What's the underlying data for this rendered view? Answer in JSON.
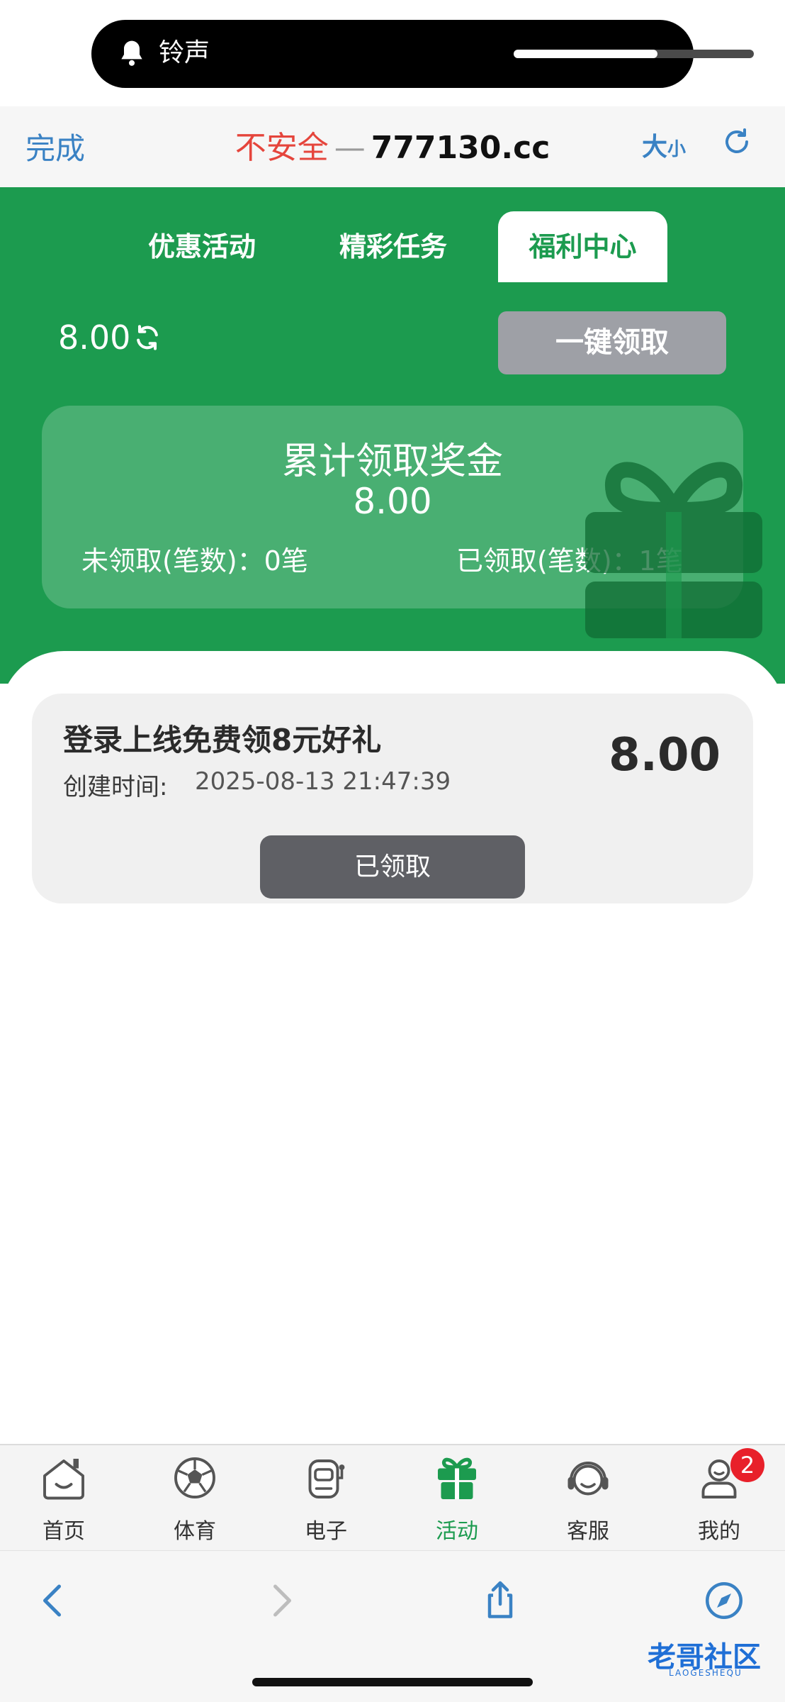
{
  "island": {
    "label": "铃声",
    "volume_level": 0.6
  },
  "browser": {
    "done_label": "完成",
    "insecure_label": "不安全",
    "separator": "—",
    "domain": "777130.cc",
    "fontsize_big": "大",
    "fontsize_small": "小"
  },
  "tabs": [
    {
      "label": "优惠活动",
      "active": false
    },
    {
      "label": "精彩任务",
      "active": false
    },
    {
      "label": "福利中心",
      "active": true
    }
  ],
  "wallet": {
    "balance": "8.00",
    "claim_all_label": "一键领取"
  },
  "summary": {
    "title": "累计领取奖金",
    "amount": "8.00",
    "unclaimed_label": "未领取(笔数)：0笔",
    "claimed_label": "已领取(笔数)：1笔"
  },
  "rewards": [
    {
      "title": "登录上线免费领8元好礼",
      "time_label": "创建时间:",
      "time": "2025-08-13 21:47:39",
      "amount": "8.00",
      "status_label": "已领取"
    }
  ],
  "bottom_nav": [
    {
      "label": "首页",
      "icon": "home-icon",
      "active": false
    },
    {
      "label": "体育",
      "icon": "soccer-ball-icon",
      "active": false
    },
    {
      "label": "电子",
      "icon": "slot-machine-icon",
      "active": false
    },
    {
      "label": "活动",
      "icon": "gift-icon",
      "active": true
    },
    {
      "label": "客服",
      "icon": "headset-icon",
      "active": false
    },
    {
      "label": "我的",
      "icon": "user-icon",
      "active": false
    }
  ],
  "notification_badge": "2",
  "watermark": {
    "text": "老哥社区",
    "sub": "LAOGESHEQU"
  },
  "colors": {
    "brand_green": "#1c9b4f",
    "link_blue": "#3a82c4",
    "insecure_red": "#e5453c",
    "badge_red": "#e8202a"
  }
}
